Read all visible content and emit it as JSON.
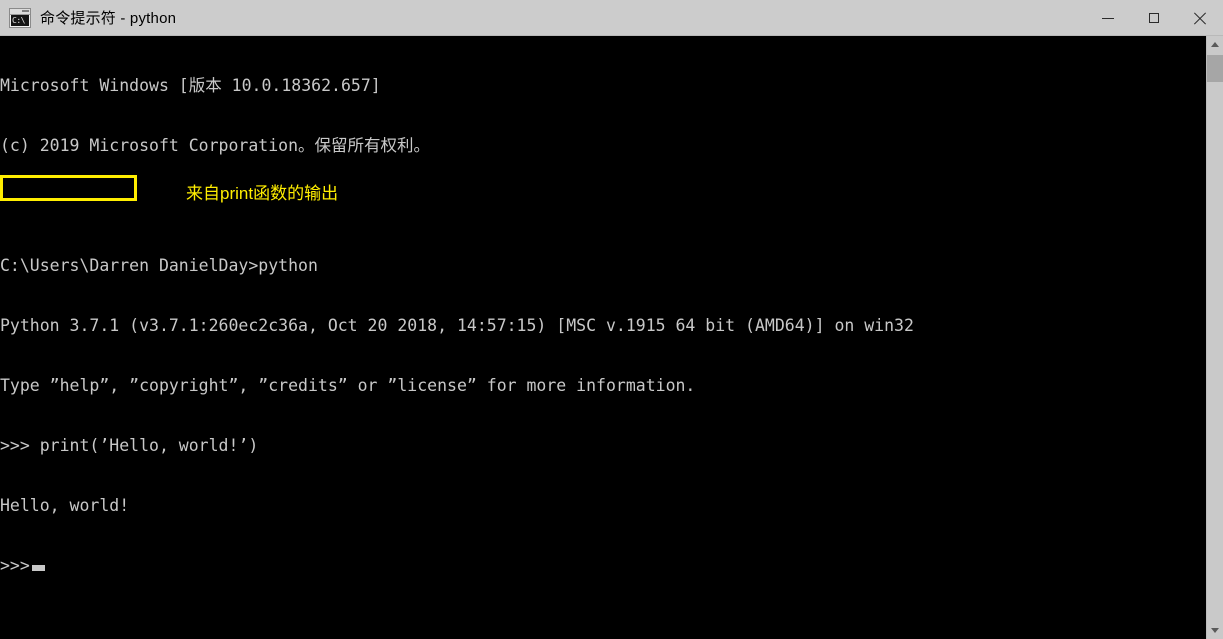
{
  "window": {
    "title": "命令提示符 - python",
    "icon": "console-icon",
    "icon_glyph": "C:\\",
    "controls": {
      "minimize_label": "—",
      "maximize_label": "□",
      "close_label": "✕"
    }
  },
  "console": {
    "background_color": "#000000",
    "text_color": "#c8c8c8",
    "lines": [
      "Microsoft Windows [版本 10.0.18362.657]",
      "(c) 2019 Microsoft Corporation。保留所有权利。",
      "",
      "C:\\Users\\Darren DanielDay>python",
      "Python 3.7.1 (v3.7.1:260ec2c36a, Oct 20 2018, 14:57:15) [MSC v.1915 64 bit (AMD64)] on win32",
      "Type ”help”, ”copyright”, ”credits” or ”license” for more information.",
      ">>> print(’Hello, world!’)",
      "Hello, world!"
    ],
    "prompt": ">>>",
    "cursor": "block-cursor"
  },
  "annotations": {
    "highlight_color": "#ffee00",
    "highlight_target": "Hello, world!",
    "callout_text": "来自print函数的输出"
  },
  "scrollbar": {
    "up_arrow": "scroll-up-arrow",
    "down_arrow": "scroll-down-arrow",
    "thumb": "scroll-thumb"
  }
}
